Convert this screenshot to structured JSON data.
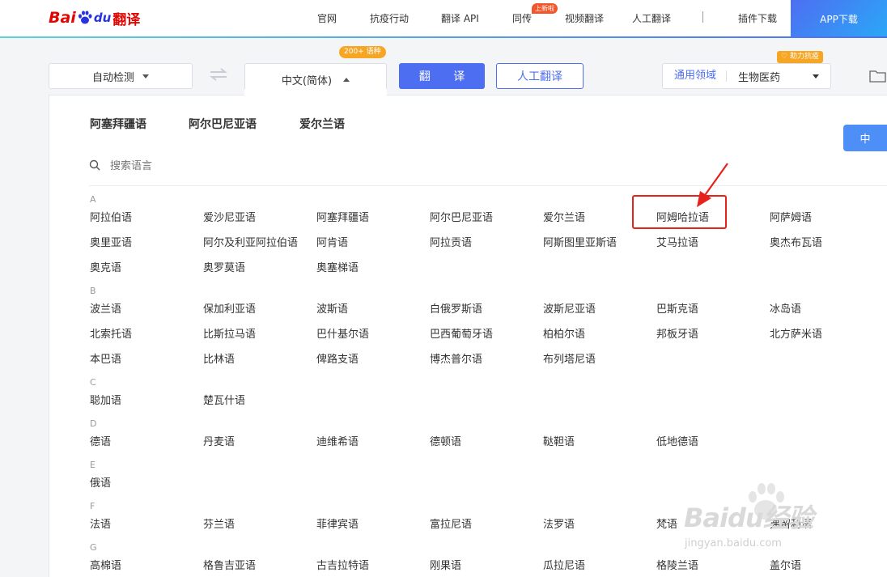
{
  "logo": {
    "bai": "Bai",
    "du": "du",
    "product": "翻译"
  },
  "nav": {
    "items": [
      "官网",
      "抗疫行动",
      "翻译 API",
      "同传",
      "视频翻译",
      "人工翻译",
      "插件下载"
    ],
    "new_badge": "上新啦",
    "app_download": "APP下载"
  },
  "toolbar": {
    "source_lang": "自动检测",
    "target_lang": "中文(简体)",
    "lang_count_badge": "200+ 语种",
    "translate_button": "翻 译",
    "human_button": "人工翻译",
    "domain_label": "通用领域",
    "domain_value": "生物医药",
    "help_badge": "助力抗疫"
  },
  "panel": {
    "recent": [
      "阿塞拜疆语",
      "阿尔巴尼亚语",
      "爱尔兰语"
    ],
    "zh_button": "中",
    "search_placeholder": "搜索语言",
    "groups": [
      {
        "letter": "A",
        "languages": [
          "阿拉伯语",
          "爱沙尼亚语",
          "阿塞拜疆语",
          "阿尔巴尼亚语",
          "爱尔兰语",
          "阿姆哈拉语",
          "阿萨姆语",
          "奥里亚语",
          "阿尔及利亚阿拉伯语",
          "阿肯语",
          "阿拉贡语",
          "阿斯图里亚斯语",
          "艾马拉语",
          "奥杰布瓦语",
          "奥克语",
          "奥罗莫语",
          "奥塞梯语"
        ]
      },
      {
        "letter": "B",
        "languages": [
          "波兰语",
          "保加利亚语",
          "波斯语",
          "白俄罗斯语",
          "波斯尼亚语",
          "巴斯克语",
          "冰岛语",
          "北索托语",
          "比斯拉马语",
          "巴什基尔语",
          "巴西葡萄牙语",
          "柏柏尔语",
          "邦板牙语",
          "北方萨米语",
          "本巴语",
          "比林语",
          "俾路支语",
          "博杰普尔语",
          "布列塔尼语"
        ]
      },
      {
        "letter": "C",
        "languages": [
          "聪加语",
          "楚瓦什语"
        ]
      },
      {
        "letter": "D",
        "languages": [
          "德语",
          "丹麦语",
          "迪维希语",
          "德顿语",
          "鞑靼语",
          "低地德语"
        ]
      },
      {
        "letter": "E",
        "languages": [
          "俄语"
        ]
      },
      {
        "letter": "F",
        "languages": [
          "法语",
          "芬兰语",
          "菲律宾语",
          "富拉尼语",
          "法罗语",
          "梵语",
          "弗留利语"
        ]
      },
      {
        "letter": "G",
        "languages": [
          "高棉语",
          "格鲁吉亚语",
          "古吉拉特语",
          "刚果语",
          "瓜拉尼语",
          "格陵兰语",
          "盖尔语"
        ]
      }
    ]
  },
  "watermark": {
    "text": "Baidu经验",
    "url": "jingyan.baidu.com"
  }
}
